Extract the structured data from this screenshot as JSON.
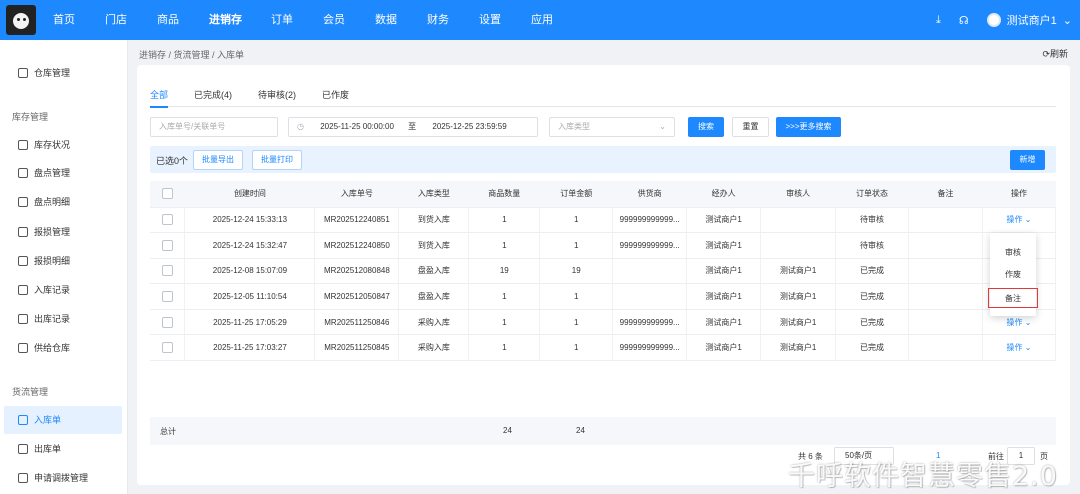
{
  "topbar": {
    "nav": [
      "首页",
      "门店",
      "商品",
      "进销存",
      "订单",
      "会员",
      "数据",
      "财务",
      "设置",
      "应用"
    ],
    "active_nav": "进销存",
    "user_name": "测试商户1",
    "icons": [
      "download-icon",
      "headset-icon"
    ]
  },
  "sidebar": {
    "top_items": [
      {
        "label": "仓库管理",
        "icon": "home-icon"
      }
    ],
    "section1_title": "库存管理",
    "section1_items": [
      {
        "label": "库存状况",
        "icon": "home-icon"
      },
      {
        "label": "盘点管理",
        "icon": "home-icon"
      },
      {
        "label": "盘点明细",
        "icon": "document-icon"
      },
      {
        "label": "报损管理",
        "icon": "trash-icon"
      },
      {
        "label": "报损明细",
        "icon": "document-icon"
      },
      {
        "label": "入库记录",
        "icon": "document-icon"
      },
      {
        "label": "出库记录",
        "icon": "document-icon"
      },
      {
        "label": "供给仓库",
        "icon": "refresh-icon"
      }
    ],
    "section2_title": "货流管理",
    "section2_items": [
      {
        "label": "入库单",
        "icon": "inbox-icon",
        "active": true
      },
      {
        "label": "出库单",
        "icon": "inbox-icon"
      },
      {
        "label": "申请调拨管理",
        "icon": "list-icon"
      }
    ]
  },
  "breadcrumb": "进销存 / 货流管理 / 入库单",
  "refresh_label": "刷新",
  "tabs": [
    "全部",
    "已完成(4)",
    "待审核(2)",
    "已作废"
  ],
  "active_tab": "全部",
  "filters": {
    "order_placeholder": "入库单号/关联单号",
    "date_start": "2025-11-25 00:00:00",
    "date_sep": "至",
    "date_end": "2025-12-25 23:59:59",
    "type_placeholder": "入库类型",
    "search_btn": "搜索",
    "reset_btn": "重置",
    "more_btn": ">>>更多搜索"
  },
  "selection": {
    "selected_text": "已选0个",
    "export_btn": "批量导出",
    "print_btn": "批量打印",
    "new_btn": "新增"
  },
  "table": {
    "headers": [
      "",
      "创建时间",
      "入库单号",
      "入库类型",
      "商品数量",
      "订单金额",
      "供货商",
      "经办人",
      "审核人",
      "订单状态",
      "备注",
      "操作"
    ],
    "rows": [
      {
        "time": "2025-12-24 15:33:13",
        "no": "MR202512240851",
        "type": "到货入库",
        "qty": "1",
        "amount": "1",
        "supplier": "999999999999...",
        "handler": "测试商户1",
        "auditor": "",
        "status": "待审核",
        "remark": "",
        "op": "操作"
      },
      {
        "time": "2025-12-24 15:32:47",
        "no": "MR202512240850",
        "type": "到货入库",
        "qty": "1",
        "amount": "1",
        "supplier": "999999999999...",
        "handler": "测试商户1",
        "auditor": "",
        "status": "待审核",
        "remark": "",
        "op": ""
      },
      {
        "time": "2025-12-08 15:07:09",
        "no": "MR202512080848",
        "type": "盘盈入库",
        "qty": "19",
        "amount": "19",
        "supplier": "",
        "handler": "测试商户1",
        "auditor": "测试商户1",
        "status": "已完成",
        "remark": "",
        "op": ""
      },
      {
        "time": "2025-12-05 11:10:54",
        "no": "MR202512050847",
        "type": "盘盈入库",
        "qty": "1",
        "amount": "1",
        "supplier": "",
        "handler": "测试商户1",
        "auditor": "测试商户1",
        "status": "已完成",
        "remark": "",
        "op": ""
      },
      {
        "time": "2025-11-25 17:05:29",
        "no": "MR202511250846",
        "type": "采购入库",
        "qty": "1",
        "amount": "1",
        "supplier": "999999999999...",
        "handler": "测试商户1",
        "auditor": "测试商户1",
        "status": "已完成",
        "remark": "",
        "op": "操作"
      },
      {
        "time": "2025-11-25 17:03:27",
        "no": "MR202511250845",
        "type": "采购入库",
        "qty": "1",
        "amount": "1",
        "supplier": "999999999999...",
        "handler": "测试商户1",
        "auditor": "测试商户1",
        "status": "已完成",
        "remark": "",
        "op": "操作"
      }
    ],
    "total_label": "总计",
    "total_qty": "24",
    "total_amount": "24"
  },
  "dropdown_menu": [
    "审核",
    "作废",
    "备注"
  ],
  "pager": {
    "total": "共 6 条",
    "page_size": "50条/页",
    "current": "1",
    "goto_label": "前往",
    "goto_value": "1",
    "page_unit": "页"
  },
  "watermark": "千呼软件智慧零售2.0"
}
